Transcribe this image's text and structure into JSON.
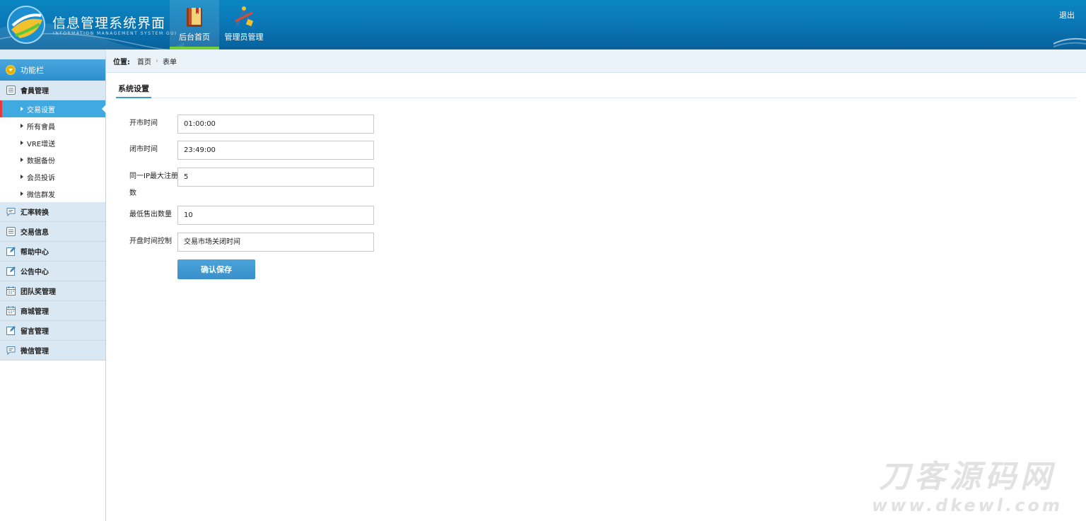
{
  "header": {
    "title": "信息管理系统界面",
    "subtitle": "INFORMATION MANAGEMENT SYSTEM GUI",
    "nav": [
      {
        "label": "后台首页",
        "icon": "book-icon",
        "active": true
      },
      {
        "label": "管理员管理",
        "icon": "tools-icon",
        "active": false
      }
    ],
    "logout": "退出"
  },
  "sidebar": {
    "title": "功能栏",
    "groups": [
      {
        "label": "會員管理",
        "icon": "list-icon",
        "items": [
          {
            "label": "交易设置",
            "active": true
          },
          {
            "label": "所有會員"
          },
          {
            "label": "VRE增送"
          },
          {
            "label": "数据备份"
          },
          {
            "label": "会员投诉"
          },
          {
            "label": "微信群发"
          }
        ]
      },
      {
        "label": "汇率转换",
        "icon": "chat-icon"
      },
      {
        "label": "交易信息",
        "icon": "list-icon"
      },
      {
        "label": "帮助中心",
        "icon": "edit-icon"
      },
      {
        "label": "公告中心",
        "icon": "edit-icon"
      },
      {
        "label": "团队奖管理",
        "icon": "calendar-icon"
      },
      {
        "label": "商城管理",
        "icon": "calendar-icon"
      },
      {
        "label": "留言管理",
        "icon": "edit-icon"
      },
      {
        "label": "微信管理",
        "icon": "chat-icon"
      }
    ]
  },
  "breadcrumb": {
    "label": "位置:",
    "items": [
      "首页",
      "表单"
    ],
    "separator": "›"
  },
  "section": {
    "title": "系统设置"
  },
  "form": {
    "fields": [
      {
        "label": "开市时间",
        "value": "01:00:00"
      },
      {
        "label": "闭市时间",
        "value": "23:49:00"
      },
      {
        "label": "同一IP最大注册",
        "label_cont": "数",
        "value": "5"
      },
      {
        "label": "最低售出数量",
        "value": "10"
      },
      {
        "label": "开盘时间控制",
        "value": "交易市场关闭时间"
      }
    ],
    "submit": "确认保存"
  },
  "watermark": {
    "line1": "刀客源码网",
    "line2": "www.dkewl.com"
  },
  "colors": {
    "header": "#0a74b3",
    "accent": "#40a9e0",
    "active_marker": "#e53a3a",
    "nav_underline": "#6fcf3a"
  }
}
